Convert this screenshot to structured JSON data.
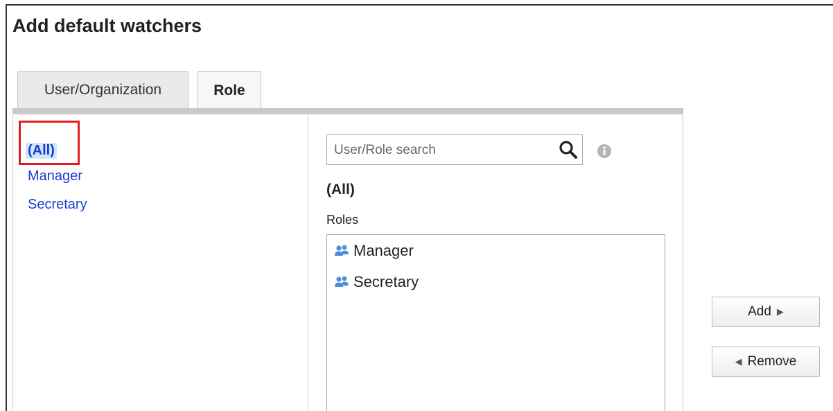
{
  "dialog": {
    "title": "Add default watchers"
  },
  "tabs": [
    {
      "label": "User/Organization",
      "active": false
    },
    {
      "label": "Role",
      "active": true
    }
  ],
  "role_nav": {
    "items": [
      {
        "label": "(All)",
        "selected": true
      },
      {
        "label": "Manager",
        "selected": false
      },
      {
        "label": "Secretary",
        "selected": false
      }
    ]
  },
  "search": {
    "placeholder": "User/Role search",
    "value": ""
  },
  "selection": {
    "heading": "(All)",
    "list_label": "Roles",
    "items": [
      {
        "label": "Manager",
        "icon": "role-group-icon"
      },
      {
        "label": "Secretary",
        "icon": "role-group-icon"
      }
    ]
  },
  "actions": {
    "add_label": "Add",
    "remove_label": "Remove"
  },
  "colors": {
    "link": "#1a3ccf",
    "highlight": "#e21c1c",
    "selected_bg": "#cfe6ff",
    "role_icon": "#4a90d9"
  }
}
